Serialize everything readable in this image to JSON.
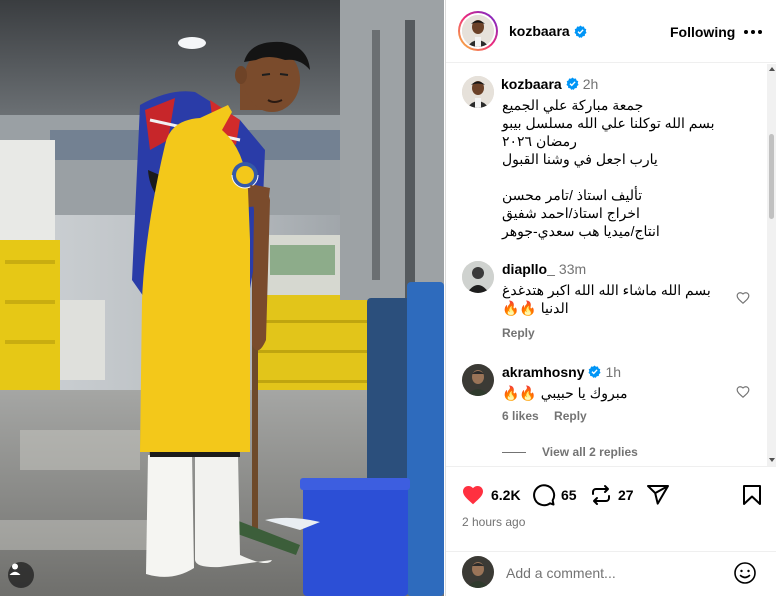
{
  "post": {
    "username": "kozbaara",
    "follow_label": "Following",
    "time_ago": "2h",
    "caption_lines": [
      "جمعة مباركة علي الجميع",
      "بسم الله توكلنا علي الله مسلسل بيبو",
      "رمضان ٢٠٢٦",
      "يارب اجعل في وشنا القبول",
      "",
      "تأليف استاذ /تامر محسن",
      "اخراج استاذ/احمد شفيق",
      "انتاج/ميديا هب سعدي-جوهر"
    ],
    "likes_count": "6.2K",
    "comments_count": "65",
    "reposts_count": "27",
    "posted_time": "2 hours ago"
  },
  "comments": [
    {
      "username": "diapllo_",
      "time_ago": "33m",
      "text_lines": [
        "بسم الله ماشاء الله الله اكبر هتدغدغ",
        "الدنيا 🔥🔥"
      ],
      "reply_label": "Reply"
    },
    {
      "username": "akramhosny",
      "time_ago": "1h",
      "text_lines": [
        "مبروك يا حبيبي 🔥🔥"
      ],
      "likes_label": "6 likes",
      "reply_label": "Reply",
      "view_replies_label": "View all 2 replies"
    }
  ],
  "comment_box": {
    "placeholder": "Add a comment..."
  },
  "colors": {
    "verified": "#0095f6",
    "like_red": "#ff3040",
    "muted": "#737373",
    "apron_yellow": "#f3c81a"
  },
  "icons": [
    "more-icon",
    "verified-icon",
    "heart-icon",
    "comment-icon",
    "repost-icon",
    "share-icon",
    "bookmark-icon",
    "emoji-icon",
    "user-tag-icon"
  ]
}
